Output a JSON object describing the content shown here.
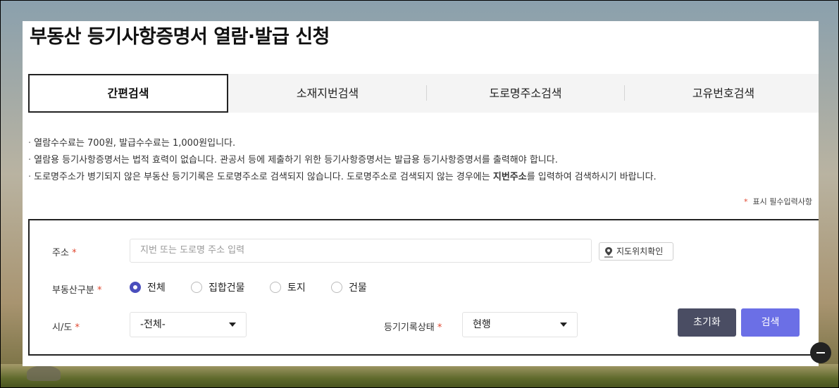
{
  "page": {
    "title": "부동산 등기사항증명서 열람·발급 신청"
  },
  "tabs": [
    {
      "label": "간편검색",
      "active": true
    },
    {
      "label": "소재지번검색",
      "active": false
    },
    {
      "label": "도로명주소검색",
      "active": false
    },
    {
      "label": "고유번호검색",
      "active": false
    }
  ],
  "notices": {
    "line1": "열람수수료는  700원, 발급수수료는  1,000원입니다.",
    "line2": "열람용 등기사항증명서는 법적 효력이 없습니다. 관공서 등에 제출하기 위한 등기사항증명서는 발급용 등기사항증명서를 출력해야 합니다.",
    "line3_before": "도로명주소가 병기되지 않은 부동산 등기기록은 도로명주소로 검색되지 않습니다. 도로명주소로 검색되지 않는 경우에는 ",
    "line3_bold": "지번주소",
    "line3_after": "를 입력하여 검색하시기 바랍니다."
  },
  "required_note": {
    "star": "*",
    "text": "표시 필수입력사항"
  },
  "form": {
    "address_label": "주소",
    "address_placeholder": "지번 또는 도로명 주소 입력",
    "map_button": "지도위치확인",
    "type_label": "부동산구분",
    "type_options": [
      {
        "label": "전체",
        "selected": true
      },
      {
        "label": "집합건물",
        "selected": false
      },
      {
        "label": "토지",
        "selected": false
      },
      {
        "label": "건물",
        "selected": false
      }
    ],
    "sido_label": "시/도",
    "sido_value": "-전체-",
    "status_label": "등기기록상태",
    "status_value": "현행",
    "reset_button": "초기화",
    "search_button": "검색",
    "required_mark": "*"
  },
  "colors": {
    "accent": "#6b6fe6",
    "reset_bg": "#4a4d63",
    "required": "#e0472f",
    "radio_selected": "#4a4ebd"
  }
}
